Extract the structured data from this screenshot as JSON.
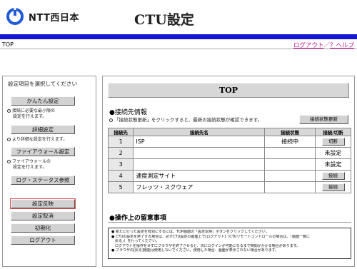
{
  "brand": {
    "name": "NTT西日本",
    "logo_icon": "ntt-logo-icon",
    "logo_color": "#1f5bd6"
  },
  "app": {
    "title": "CTU設定"
  },
  "colors": {
    "header_bar": "#1515d6",
    "link": "#c21b8e"
  },
  "breadcrumb": "TOP",
  "nav": {
    "logout": "ログアウト",
    "separator": "／",
    "help": "？ヘルプ"
  },
  "sidebar": {
    "heading": "設定項目を選択してください",
    "buttons": {
      "easy": "かんたん設定",
      "detail": "詳細設定",
      "firewall": "ファイアウォール設定",
      "log": "ログ・ステータス参照",
      "apply": "設定反映",
      "cancel": "設定取消",
      "init": "初期化",
      "logout": "ログアウト"
    },
    "notes": {
      "easy_1": "接続に必要な最小限の",
      "easy_2": "設定を行えます。",
      "detail": "より詳細な設定を行えます。",
      "fw_1": "ファイアウォールの",
      "fw_2": "設定を行えます。"
    }
  },
  "main": {
    "title": "TOP",
    "section": {
      "bullet": "●",
      "label": "接続先情報"
    },
    "hint": "「接続状態更新」をクリックすると、最新の接続状態が確認できます。",
    "refresh_button": "接続状態更新",
    "table": {
      "headers": [
        "接続先",
        "接続先名",
        "接続状態",
        "接続/切断"
      ],
      "rows": [
        {
          "num": "1",
          "name": "ISP",
          "status": "接続中",
          "action": "切断",
          "action_type": "button"
        },
        {
          "num": "2",
          "name": "",
          "status": "",
          "action": "未設定",
          "action_type": "text"
        },
        {
          "num": "3",
          "name": "",
          "status": "",
          "action": "未設定",
          "action_type": "text"
        },
        {
          "num": "4",
          "name": "速度測定サイト",
          "status": "",
          "action": "接続",
          "action_type": "button"
        },
        {
          "num": "5",
          "name": "フレッツ・スクウェア",
          "status": "",
          "action": "接続",
          "action_type": "button"
        }
      ]
    },
    "notice": {
      "heading": "●操作上の留意事項",
      "items": [
        "● 新たに行った設定を有効にするには、TOP画面の「設定反映」ボタンをクリックしてください。",
        "● CTUの設定を終了する場合は、必ずCTU設定の画面上で[ログアウト]（CTUリモートコントロールの場合は、「画面一覧に",
        "　戻る」）を行ってください。",
        "　ログアウトを操作をせずにブラウザを終了させると、次にログインが可能になるまで時間がかかる場合があります。",
        "● ブラウザの[戻る]機能は使用しないでください。使用した場合、画面が表示されない場合があります。"
      ]
    }
  }
}
